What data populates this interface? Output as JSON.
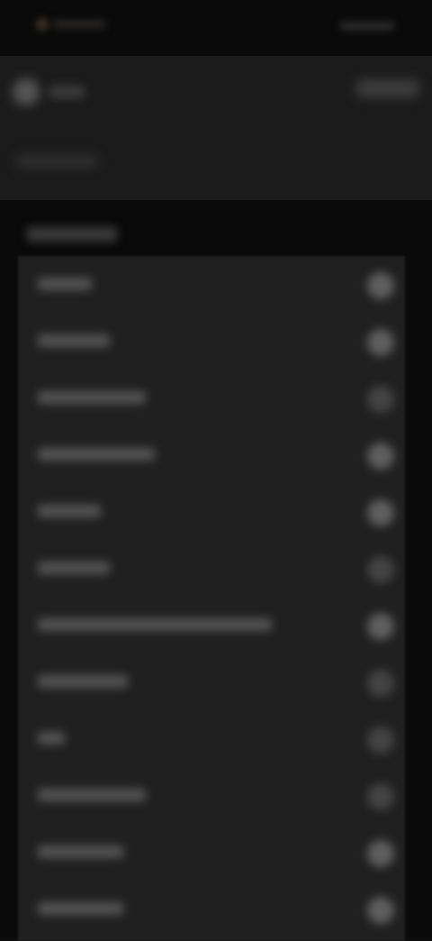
{
  "status_bar": {
    "time": "",
    "indicators": ""
  },
  "header": {
    "back_label": "",
    "action_label": "",
    "subtitle": ""
  },
  "section": {
    "title": ""
  },
  "list": {
    "items": [
      {
        "label": "",
        "icon": "chevron-icon"
      },
      {
        "label": "",
        "icon": "chevron-icon"
      },
      {
        "label": "",
        "icon": "chevron-icon"
      },
      {
        "label": "",
        "icon": "chevron-icon"
      },
      {
        "label": "",
        "icon": "chevron-icon"
      },
      {
        "label": "",
        "icon": "chevron-icon"
      },
      {
        "label": "",
        "icon": "chevron-icon"
      },
      {
        "label": "",
        "icon": "chevron-icon"
      },
      {
        "label": "",
        "icon": "chevron-icon"
      },
      {
        "label": "",
        "icon": "chevron-icon"
      },
      {
        "label": "",
        "icon": "chevron-icon"
      },
      {
        "label": "",
        "icon": "chevron-icon"
      }
    ]
  },
  "colors": {
    "background": "#0a0a0a",
    "header": "#1b1b1b",
    "list_bg": "#202020",
    "accent": "#3a3026"
  }
}
